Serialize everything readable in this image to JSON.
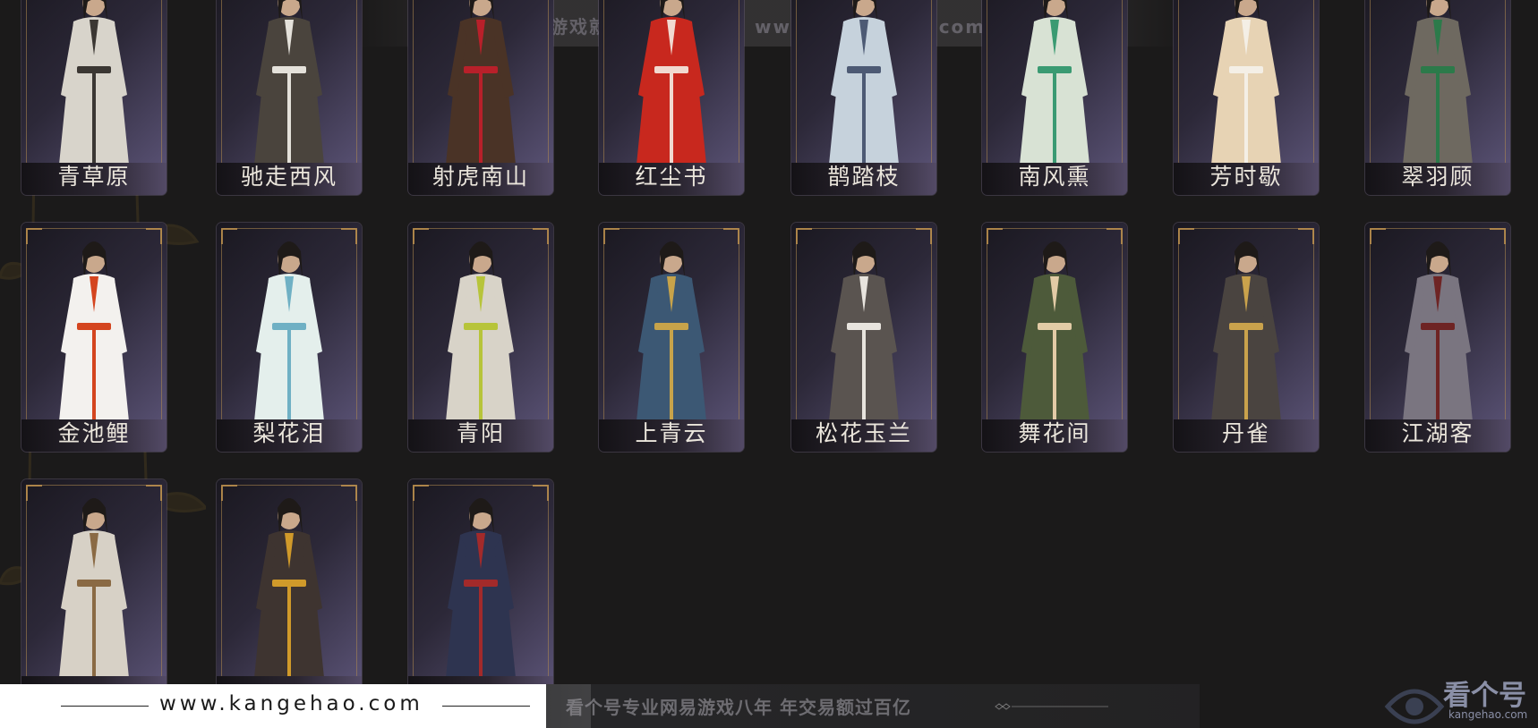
{
  "watermark_top": "网易游戏就选看个号   网址：www.kangehao.com",
  "outfits": [
    {
      "name": "青草原",
      "robe": "#d8d4cb",
      "accent": "#3b3733"
    },
    {
      "name": "驰走西风",
      "robe": "#4a443d",
      "accent": "#e4e1da"
    },
    {
      "name": "射虎南山",
      "robe": "#4a3326",
      "accent": "#b8202a"
    },
    {
      "name": "红尘书",
      "robe": "#c8281e",
      "accent": "#f1d9d0"
    },
    {
      "name": "鹊踏枝",
      "robe": "#c6d2dc",
      "accent": "#4d5a74"
    },
    {
      "name": "南风熏",
      "robe": "#d8e2d4",
      "accent": "#3a9a72"
    },
    {
      "name": "芳时歇",
      "robe": "#e7d3b4",
      "accent": "#f4efe6"
    },
    {
      "name": "翠羽顾",
      "robe": "#6e6960",
      "accent": "#2c7a4a"
    },
    {
      "name": "金池鲤",
      "robe": "#f3f1ee",
      "accent": "#d4451f"
    },
    {
      "name": "梨花泪",
      "robe": "#e4efec",
      "accent": "#6fb0c4"
    },
    {
      "name": "青阳",
      "robe": "#d8d3c8",
      "accent": "#b7c43a"
    },
    {
      "name": "上青云",
      "robe": "#3c5874",
      "accent": "#c7a34a"
    },
    {
      "name": "松花玉兰",
      "robe": "#5a5450",
      "accent": "#e8e4de"
    },
    {
      "name": "舞花间",
      "robe": "#4d5a3a",
      "accent": "#e2cba6"
    },
    {
      "name": "丹雀",
      "robe": "#4a4440",
      "accent": "#c9a24c"
    },
    {
      "name": "江湖客",
      "robe": "#7a7580",
      "accent": "#6e2424"
    },
    {
      "name": "",
      "robe": "#d7d1c6",
      "accent": "#8a6a44"
    },
    {
      "name": "",
      "robe": "#3e3430",
      "accent": "#d09a2a"
    },
    {
      "name": "",
      "robe": "#2e3450",
      "accent": "#a32a2a"
    }
  ],
  "footer": {
    "url": "www.kangehao.com",
    "slogan": "看个号专业网易游戏八年   年交易额过百亿"
  },
  "logo": {
    "text": "看个号",
    "sub": "kangehao.com"
  }
}
